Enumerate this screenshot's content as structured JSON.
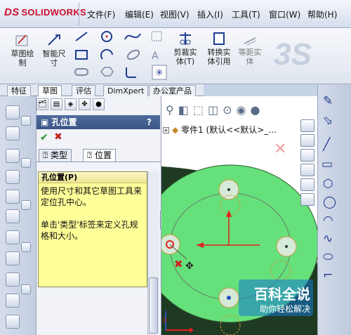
{
  "titlebar": {
    "logo_text": "SOLIDWORKS",
    "logo_prefix": "DS",
    "menus": [
      "文件(F)",
      "编辑(E)",
      "视图(V)",
      "插入(I)",
      "工具(T)",
      "窗口(W)",
      "帮助(H)"
    ]
  },
  "ribbon": {
    "sketch_draw": [
      "草图绘",
      "制"
    ],
    "smart_dim": [
      "智能尺",
      "寸"
    ],
    "trim": [
      "剪裁实",
      "体(T)"
    ],
    "convert": [
      "转换实",
      "体引用"
    ],
    "offset": [
      "等距实",
      "体"
    ]
  },
  "tabs": [
    "特征",
    "草图",
    "评估",
    "DimXpert",
    "办公室产品"
  ],
  "pm": {
    "title": "孔位置",
    "help": "?",
    "ok": "✔",
    "cancel": "✖",
    "tab_type": "类型",
    "tab_position": "位置",
    "section_title": "孔位置(P)",
    "message": "使用尺寸和其它草图工具来定位孔中心。\n\n单击'类型'标签来定义孔规格和大小。"
  },
  "graphics": {
    "tree_node": "零件1 (默认<<默认>_..."
  },
  "watermark": {
    "title": "百科全说",
    "subtitle": "助你轻松解决"
  },
  "colors": {
    "part_green": "#66e07a",
    "part_dark": "#1f3a22",
    "sketch_red": "#e02020",
    "pm_header": "#3f5a8c",
    "message_bg": "#ffff99"
  }
}
